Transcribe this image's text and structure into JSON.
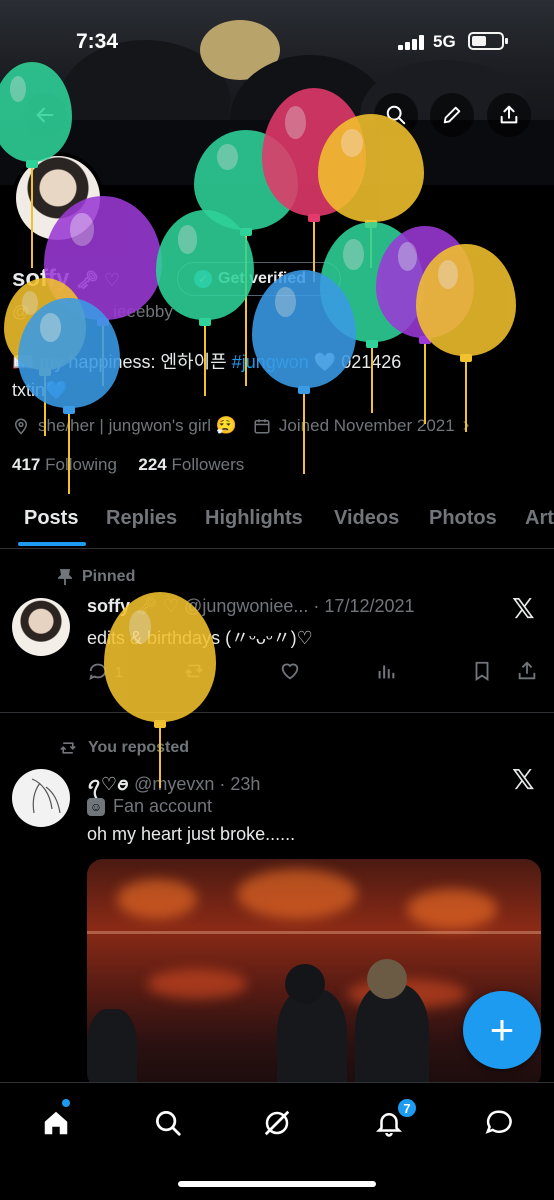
{
  "status_bar": {
    "time": "7:34",
    "network": "5G"
  },
  "profile": {
    "display_name": "soffy",
    "name_decoration": "🗝 ♡",
    "handle_visible": "@",
    "handle_visible_tail": "ieeebby",
    "get_verified": "Get verified",
    "bio_line1_prefix": "my happiness: 엔하이픈",
    "bio_hashtag": "#jungwon",
    "bio_line1_suffix": "🤍 021426",
    "bio_line2": "txtin💙",
    "location": "she/her | jungwon's girl 😮‍💨",
    "joined": "Joined November 2021",
    "following_count": "417",
    "following_label": "Following",
    "followers_count": "224",
    "followers_label": "Followers"
  },
  "tabs": [
    "Posts",
    "Replies",
    "Highlights",
    "Videos",
    "Photos",
    "Art"
  ],
  "posts": [
    {
      "context": "Pinned",
      "name": "soffy",
      "name_decoration": "🗝 ♡",
      "handle": "@jungwoniee...",
      "date": "· 17/12/2021",
      "text": "edits & birthdays (〃ᵕᴗᵕ〃)♡",
      "reply_count": "1"
    },
    {
      "context": "You reposted",
      "name": "ꪖ♡ꪮ",
      "handle": "@myevxn",
      "date": "· 23h",
      "label": "Fan account",
      "text": "oh my heart just broke......"
    }
  ],
  "bottom_nav": {
    "notifications_badge": "7"
  },
  "colors": {
    "accent": "#1d9bf0",
    "background": "#000000",
    "secondary_text": "#71767b",
    "balloon_green": "#2fd39a",
    "balloon_purple": "#9b3ad6",
    "balloon_red": "#e33a6b",
    "balloon_yellow": "#f2c12e",
    "balloon_blue": "#3a9be6"
  },
  "icons": [
    "back-arrow-icon",
    "search-icon",
    "pencil-icon",
    "share-icon",
    "location-icon",
    "calendar-icon",
    "chevron-right-icon",
    "pin-icon",
    "repost-icon",
    "x-logo-icon",
    "reply-icon",
    "like-icon",
    "views-icon",
    "bookmark-icon",
    "fan-account-icon",
    "compose-plus-icon",
    "home-icon",
    "explore-icon",
    "grok-icon",
    "notifications-icon",
    "messages-icon"
  ]
}
